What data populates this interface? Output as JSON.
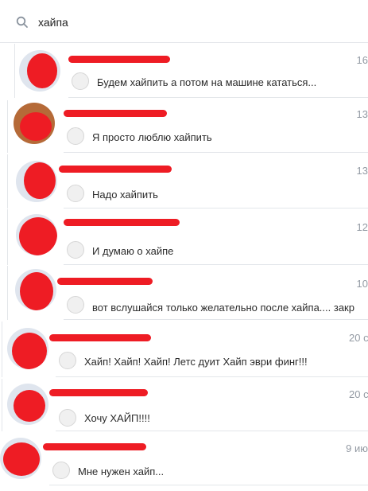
{
  "search": {
    "query": "хайпа",
    "icon": "search-icon"
  },
  "colors": {
    "redaction": "#ee1c24",
    "date_text": "#939aa3",
    "avatar_placeholder": "#dfe5ee"
  },
  "messages": [
    {
      "date": "16",
      "text": "Будем хайпить а потом на машине кататься..."
    },
    {
      "date": "13",
      "text": "Я просто люблю хайпить"
    },
    {
      "date": "13",
      "text": "Надо хайпить"
    },
    {
      "date": "12",
      "text": "И думаю о хайпе"
    },
    {
      "date": "10",
      "text": "вот вслушайся только желательно после хайпа.... закр"
    },
    {
      "date": "20 с",
      "text": "Хайп! Хайп! Хайп! Летс дуит Хайп эври финг!!!"
    },
    {
      "date": "20 с",
      "text": "Хочу ХАЙП!!!!"
    },
    {
      "date": "9 ию",
      "text": "Мне нужен хайп..."
    }
  ]
}
